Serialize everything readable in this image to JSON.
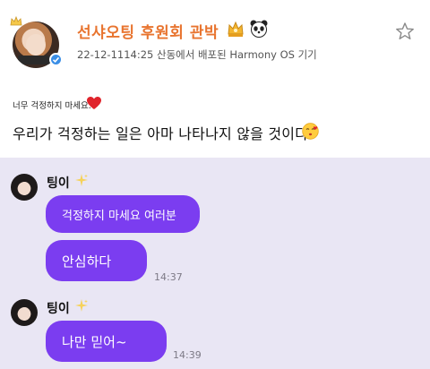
{
  "post": {
    "username": "선샤오팅 후원회 관박",
    "meta": "22-12-1114:25 산동에서 배포된 Harmony OS 기기",
    "small_note": "너무 걱정하지 마세요.",
    "body_text": "우리가 걱정하는 일은 아마 나타나지 않을 것이다.",
    "icons": [
      "crown-icon",
      "panda-icon",
      "star-icon",
      "verified-icon",
      "heart-icon",
      "kiss-face-icon"
    ],
    "colors": {
      "username": "#e8742f",
      "heart": "#e0242c",
      "verified": "#3a8ee6"
    }
  },
  "chat": {
    "background": "#e9e6f4",
    "bubble_color": "#7b3df0",
    "groups": [
      {
        "sender": "팅이",
        "messages": [
          {
            "text": "걱정하지 마세요 여러분",
            "time": ""
          },
          {
            "text": "안심하다",
            "time": "14:37"
          }
        ]
      },
      {
        "sender": "팅이",
        "messages": [
          {
            "text": "나만 믿어~",
            "time": "14:39"
          }
        ]
      }
    ]
  }
}
